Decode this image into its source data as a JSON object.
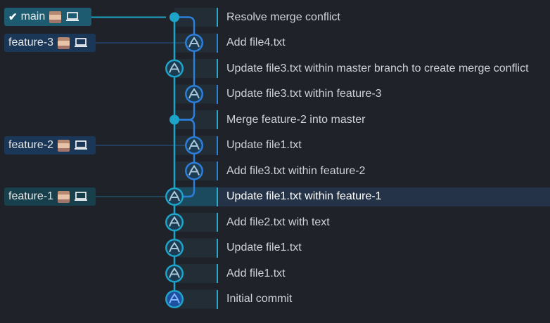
{
  "colors": {
    "background": "#1f2228",
    "main_lane": "#1ea3c9",
    "feature_lane": "#2d7ed9",
    "selected_row": "#253348"
  },
  "branches": [
    {
      "name": "main",
      "checked_out": true,
      "icons": [
        "avatar",
        "laptop-icon"
      ]
    },
    {
      "name": "feature-3",
      "checked_out": false,
      "icons": [
        "avatar",
        "laptop-icon"
      ]
    },
    {
      "name": "feature-2",
      "checked_out": false,
      "icons": [
        "avatar",
        "laptop-icon"
      ]
    },
    {
      "name": "feature-1",
      "checked_out": false,
      "icons": [
        "avatar",
        "laptop-icon"
      ]
    }
  ],
  "commits": [
    {
      "message": "Resolve merge conflict",
      "lane": "main",
      "node": "merge"
    },
    {
      "message": "Add file4.txt",
      "lane": "feature",
      "node": "avatar"
    },
    {
      "message": "Update file3.txt within master branch to create merge conflict",
      "lane": "main",
      "node": "avatar"
    },
    {
      "message": "Update file3.txt within feature-3",
      "lane": "feature",
      "node": "avatar"
    },
    {
      "message": "Merge feature-2 into master",
      "lane": "main",
      "node": "merge"
    },
    {
      "message": "Update file1.txt",
      "lane": "feature",
      "node": "avatar"
    },
    {
      "message": "Add file3.txt within feature-2",
      "lane": "feature",
      "node": "avatar"
    },
    {
      "message": "Update file1.txt within feature-1",
      "lane": "main",
      "node": "avatar",
      "selected": true
    },
    {
      "message": "Add file2.txt with text",
      "lane": "main",
      "node": "avatar"
    },
    {
      "message": "Update file1.txt",
      "lane": "main",
      "node": "avatar"
    },
    {
      "message": "Add file1.txt",
      "lane": "main",
      "node": "avatar"
    },
    {
      "message": "Initial commit",
      "lane": "main",
      "node": "avatar"
    }
  ]
}
